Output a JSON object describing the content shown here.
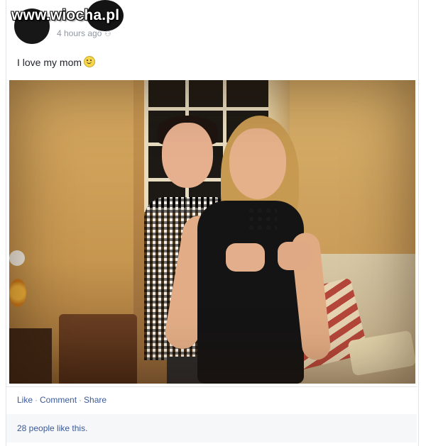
{
  "watermark": "www.wiocha.pl",
  "post": {
    "timestamp": "4 hours ago",
    "status_text": "I love my mom",
    "emoji": "smiley-icon"
  },
  "actions": {
    "like": "Like",
    "comment": "Comment",
    "share": "Share",
    "separator": "·"
  },
  "likes_summary": "28 people like this.",
  "colors": {
    "link": "#3b5998",
    "meta": "#9197a3",
    "text": "#1d2129"
  }
}
